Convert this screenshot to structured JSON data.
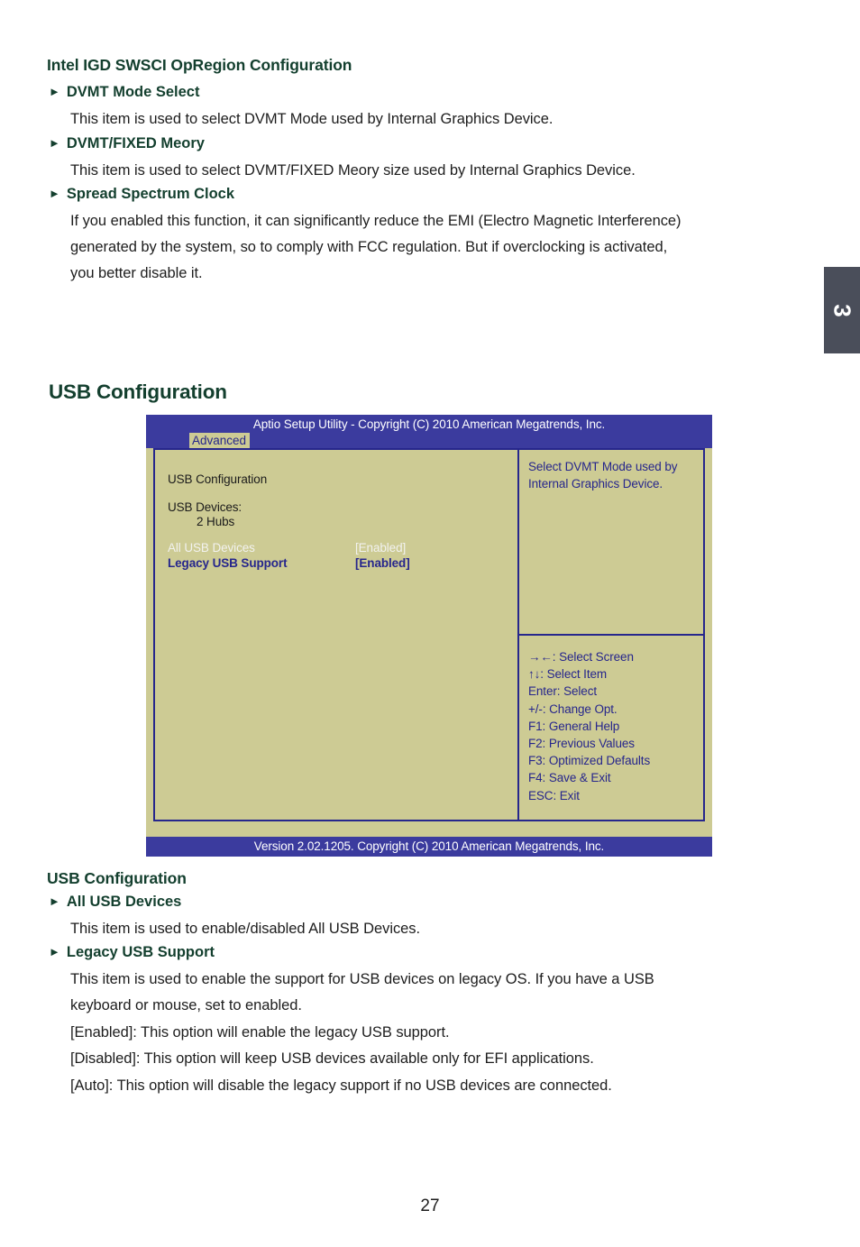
{
  "document": {
    "page_number": "27",
    "chapter_tab": "3"
  },
  "section_igd": {
    "heading": "Intel IGD SWSCI OpRegion Configuration",
    "items": [
      {
        "bullet": "►",
        "label": "DVMT Mode Select",
        "lines": [
          "This item is used to select DVMT Mode used by Internal Graphics Device."
        ]
      },
      {
        "bullet": "►",
        "label": "DVMT/FIXED Meory",
        "lines": [
          "This item is used to select DVMT/FIXED Meory size used by Internal Graphics Device."
        ]
      },
      {
        "bullet": "►",
        "label": "Spread Spectrum Clock",
        "lines": [
          "If you enabled this function, it can significantly reduce the EMI (Electro Magnetic Interference)",
          "generated by the system, so to comply with FCC regulation. But if overclocking is activated,",
          "you better disable it."
        ]
      }
    ]
  },
  "main_heading": "USB Configuration",
  "bios": {
    "title": "Aptio Setup Utility - Copyright (C) 2010 American Megatrends, Inc.",
    "active_menu": "Advanced",
    "footer": "Version 2.02.1205. Copyright (C) 2010 American Megatrends, Inc.",
    "left_panel": {
      "section_title": "USB Configuration",
      "devices_label": "USB Devices:",
      "devices_value": "2 Hubs",
      "settings": [
        {
          "name": "All USB Devices",
          "value": "[Enabled]",
          "state": "disabled"
        },
        {
          "name": "Legacy USB Support",
          "value": "[Enabled]",
          "state": "selected"
        }
      ]
    },
    "help_panel": {
      "lines": [
        "Select DVMT Mode used by",
        "Internal Graphics Device."
      ]
    },
    "key_legend": [
      "→←: Select Screen",
      "↑↓: Select Item",
      "Enter: Select",
      "+/-: Change Opt.",
      "F1:  General Help",
      "F2:  Previous Values",
      "F3: Optimized Defaults",
      "F4: Save & Exit",
      "ESC: Exit"
    ]
  },
  "section_usb": {
    "heading": "USB Configuration",
    "items": [
      {
        "bullet": "►",
        "label": "All USB Devices",
        "lines": [
          "This item is used to enable/disabled All USB Devices."
        ]
      },
      {
        "bullet": "►",
        "label": "Legacy USB Support",
        "lines": [
          "This item is used to enable the support for USB devices on legacy OS. If you have a USB",
          "keyboard or mouse, set to enabled.",
          "[Enabled]: This option will enable the legacy USB support.",
          "[Disabled]: This option will keep USB devices available only for EFI applications.",
          "[Auto]: This option will disable the legacy support if no USB devices are connected."
        ]
      }
    ]
  },
  "colors": {
    "heading_green": "#133f2e",
    "bios_blue": "#3b3b9e",
    "bios_panel": "#cdcb94",
    "bios_text_blue": "#26268c",
    "tab_gray": "#4a4e5a"
  }
}
